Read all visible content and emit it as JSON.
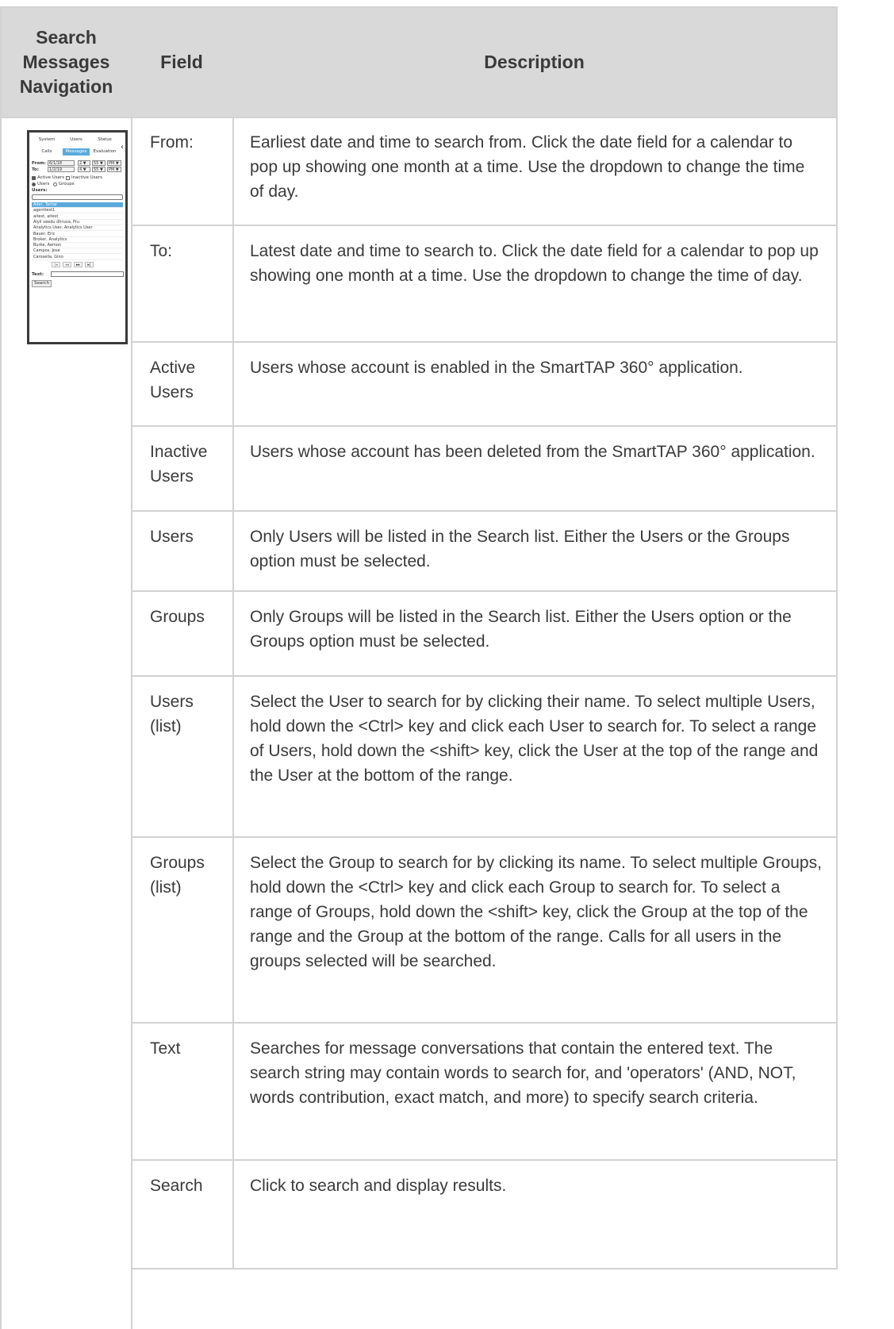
{
  "table": {
    "headers": {
      "nav": "Search\nMessages\nNavigation",
      "field": "Field",
      "description": "Description"
    },
    "rows": [
      {
        "field": "From:",
        "description": "Earliest date and time to search from.  Click the date field for a calendar to pop up showing one month at a time. Use the dropdown to change the time of day."
      },
      {
        "field": "To:",
        "description": "Latest date and time to search to.  Click the date field for a calendar to pop up showing one month at a time. Use the dropdown to change the time of day."
      },
      {
        "field": "Active Users",
        "description": "Users whose account is enabled in the SmartTAP 360° application."
      },
      {
        "field": "Inactive Users",
        "description": "Users whose account has been deleted from the SmartTAP 360° application."
      },
      {
        "field": "Users",
        "description": "Only Users will be listed in the Search list. Either the Users or the Groups option must be selected."
      },
      {
        "field": "Groups",
        "description": "Only Groups will be listed in the Search list.  Either the Users option or the Groups option must be selected."
      },
      {
        "field": "Users (list)",
        "description": "Select the User to search for by clicking their name. To select multiple Users, hold down the <Ctrl> key and click each User to search for. To select a range of Users, hold down the <shift> key, click the User at the top of the range and the User at the bottom of the range."
      },
      {
        "field": "Groups (list)",
        "description": "Select the Group to search for by clicking its name. To select multiple Groups, hold down the <Ctrl> key and click each Group to search for. To select a range of Groups, hold down the <shift> key, click the Group at the top of the range and the Group at the bottom of the range. Calls for all users in the groups selected will be searched."
      },
      {
        "field": "Text",
        "description": "Searches for message conversations that contain the entered text. The search string may contain words to search for, and 'operators' (AND, NOT, words contribution, exact match, and more) to specify search criteria."
      },
      {
        "field": "Search",
        "description": "Click to search and display results."
      }
    ]
  },
  "thumbnail": {
    "top_tabs": [
      "System",
      "Users",
      "Status"
    ],
    "sub_tabs": [
      "Calls",
      "Messages",
      "Evaluation"
    ],
    "active_sub_tab": "Messages",
    "collapse_glyph": "‹",
    "from_label": "From:",
    "from_date": "6/1/18",
    "from_hour": "2 ▼",
    "from_min": "55 ▼",
    "from_ampm": "PM ▼",
    "to_label": "To:",
    "to_date": "1/2/19",
    "to_hour": "4 ▼",
    "to_min": "55 ▼",
    "to_ampm": "PM ▼",
    "active_users_label": "Active Users",
    "inactive_users_label": "Inactive Users",
    "users_radio_label": "Users",
    "groups_radio_label": "Groups",
    "users_heading": "Users:",
    "users": [
      "Adar, Tamar",
      "agenttest1",
      "aitest, aitest",
      "Alyil veedu dhruva, Pru",
      "Analytics User, Analytics User",
      "Bauer, Eric",
      "Broker, Analytics",
      "Burke, Aemon",
      "Campos, Jose",
      "Carosella, Gino"
    ],
    "selected_user": "Adar, Tamar",
    "pager": [
      "|◂",
      "◂◂",
      "▸▸",
      "▸|"
    ],
    "text_label": "Text:",
    "search_button": "Search"
  }
}
